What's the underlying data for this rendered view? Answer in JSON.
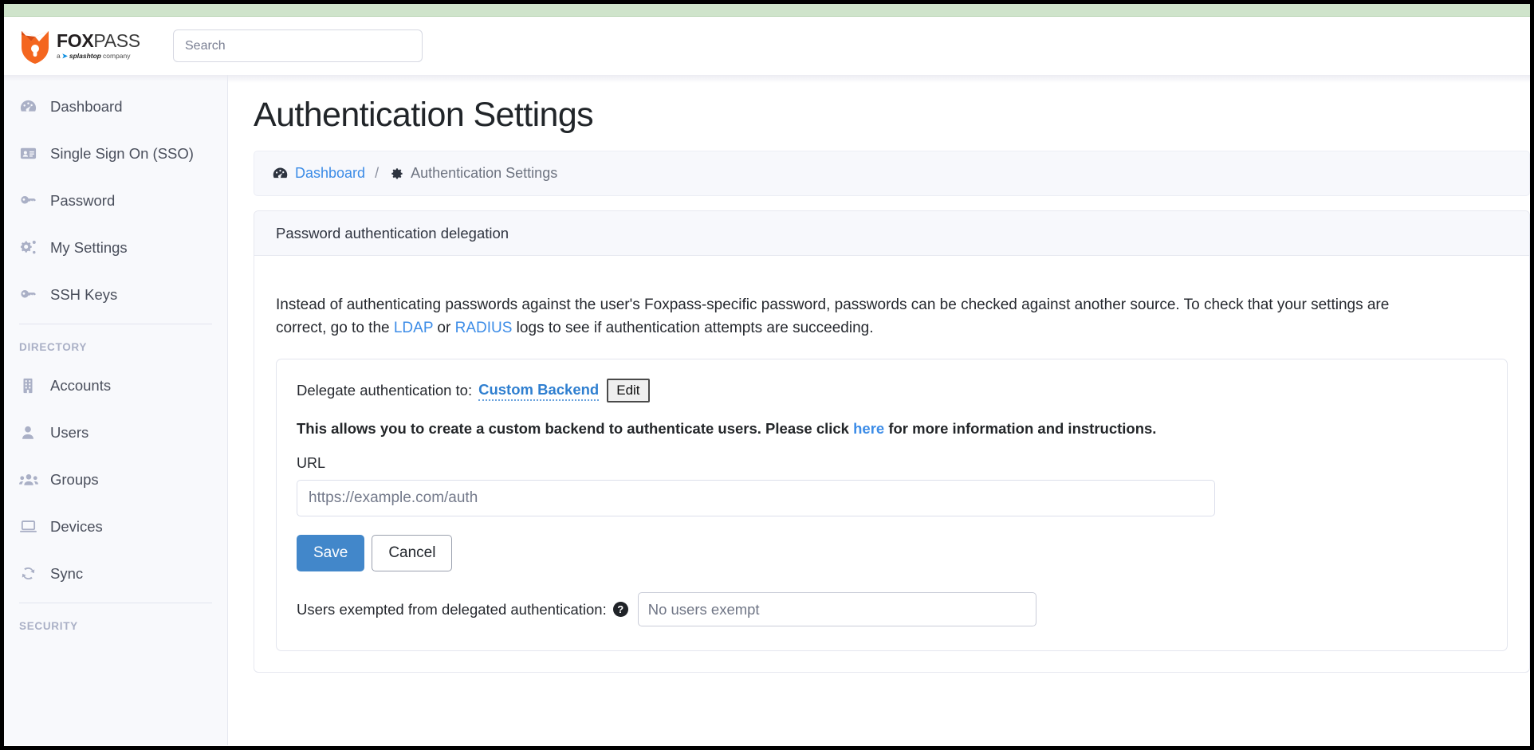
{
  "brand": {
    "name_bold": "FOX",
    "name_light": "PASS",
    "tagline_prefix": "a",
    "tagline_brand": "splashtop",
    "tagline_suffix": "company"
  },
  "search": {
    "placeholder": "Search",
    "value": ""
  },
  "sidebar": {
    "items": [
      {
        "label": "Dashboard",
        "icon": "dashboard-icon"
      },
      {
        "label": "Single Sign On (SSO)",
        "icon": "id-card-icon"
      },
      {
        "label": "Password",
        "icon": "key-icon"
      },
      {
        "label": "My Settings",
        "icon": "gears-icon"
      },
      {
        "label": "SSH Keys",
        "icon": "key-icon"
      }
    ],
    "sections": [
      {
        "title": "DIRECTORY",
        "items": [
          {
            "label": "Accounts",
            "icon": "building-icon"
          },
          {
            "label": "Users",
            "icon": "user-icon"
          },
          {
            "label": "Groups",
            "icon": "users-group-icon"
          },
          {
            "label": "Devices",
            "icon": "laptop-icon"
          },
          {
            "label": "Sync",
            "icon": "sync-icon"
          }
        ]
      },
      {
        "title": "SECURITY",
        "items": []
      }
    ]
  },
  "page": {
    "title": "Authentication Settings",
    "breadcrumb": {
      "home_label": "Dashboard",
      "separator": "/",
      "current_label": "Authentication Settings"
    }
  },
  "card": {
    "header": "Password authentication delegation",
    "intro_part1": "Instead of authenticating passwords against the user's Foxpass-specific password, passwords can be checked against another source. To check that your settings are correct, go to the ",
    "intro_link_ldap": "LDAP",
    "intro_part2": " or ",
    "intro_link_radius": "RADIUS",
    "intro_part3": " logs to see if authentication attempts are succeeding."
  },
  "panel": {
    "delegate_label": "Delegate authentication to:",
    "backend_value": "Custom Backend",
    "edit_button": "Edit",
    "allows_part1": "This allows you to create a custom backend to authenticate users. Please click ",
    "allows_link": "here",
    "allows_part2": " for more information and instructions.",
    "url_label": "URL",
    "url_placeholder": "https://example.com/auth",
    "url_value": "",
    "save_button": "Save",
    "cancel_button": "Cancel",
    "exempt_label": "Users exempted from delegated authentication:",
    "exempt_help": "?",
    "exempt_placeholder": "No users exempt",
    "exempt_value": ""
  },
  "colors": {
    "accent_blue": "#3c8ce7",
    "save_blue": "#4287ca",
    "brand_orange": "#f4661f",
    "top_strip_green": "#cfe4cb",
    "sidebar_bg": "#f8f9fc"
  }
}
